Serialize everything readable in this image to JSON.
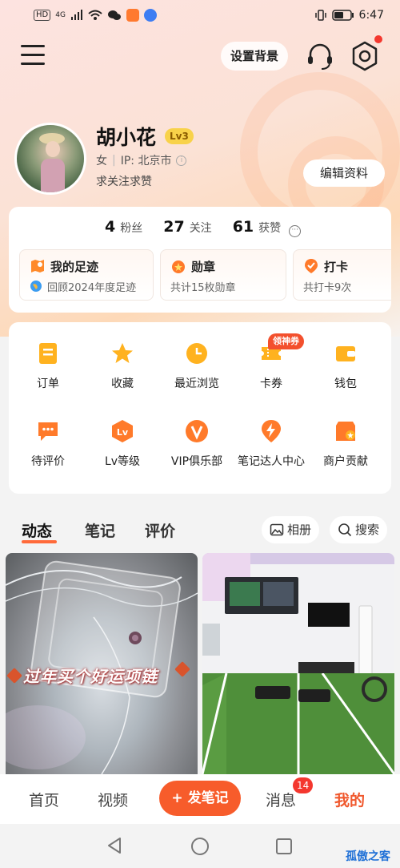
{
  "status_bar": {
    "left_indicators": [
      "HD",
      "4G"
    ],
    "battery_icon": "battery-icon",
    "time": "6:47"
  },
  "top_nav": {
    "menu_icon": "menu-icon",
    "background_button": "设置背景",
    "support_icon": "headset-icon",
    "settings_icon": "gear-icon"
  },
  "profile": {
    "name": "胡小花",
    "level_badge": "Lv3",
    "gender": "女",
    "ip_label": "IP: 北京市",
    "bio": "求关注求赞",
    "edit_button": "编辑资料"
  },
  "stats": [
    {
      "value": "4",
      "label": "粉丝"
    },
    {
      "value": "27",
      "label": "关注"
    },
    {
      "value": "61",
      "label": "获赞"
    }
  ],
  "shortcut_cards": [
    {
      "title": "我的足迹",
      "subtitle": "回顾2024年度足迹",
      "icon": "map-icon"
    },
    {
      "title": "勋章",
      "subtitle": "共计15枚勋章",
      "icon": "medal-icon"
    },
    {
      "title": "打卡",
      "subtitle": "共打卡9次",
      "icon": "checkin-icon"
    }
  ],
  "grid_items": [
    {
      "label": "订单",
      "icon": "order-icon"
    },
    {
      "label": "收藏",
      "icon": "star-icon"
    },
    {
      "label": "最近浏览",
      "icon": "clock-icon"
    },
    {
      "label": "卡券",
      "icon": "coupon-icon",
      "tag": "领神券"
    },
    {
      "label": "钱包",
      "icon": "wallet-icon"
    },
    {
      "label": "待评价",
      "icon": "comment-icon"
    },
    {
      "label": "Lv等级",
      "icon": "level-icon"
    },
    {
      "label": "VIP俱乐部",
      "icon": "vip-icon"
    },
    {
      "label": "笔记达人中心",
      "icon": "lightning-icon"
    },
    {
      "label": "商户贡献",
      "icon": "shop-icon"
    }
  ],
  "content_tabs": {
    "items": [
      "动态",
      "笔记",
      "评价"
    ],
    "active": "动态",
    "album_button": "相册",
    "search_button": "搜索"
  },
  "feed": [
    {
      "caption": "过年买个好运项链",
      "image": "necklace-photo"
    },
    {
      "caption": "",
      "image": "gym-photo"
    }
  ],
  "bottom_nav": {
    "home": "首页",
    "video": "视频",
    "post": "+ 发笔记",
    "messages": "消息",
    "messages_badge": "14",
    "mine": "我的"
  },
  "watermark": "孤傲之客",
  "colors": {
    "accent": "#f75c2b",
    "badge_red": "#f4372e",
    "icon_orange": "#ff9a1f",
    "level_yellow": "#f8d24a"
  }
}
